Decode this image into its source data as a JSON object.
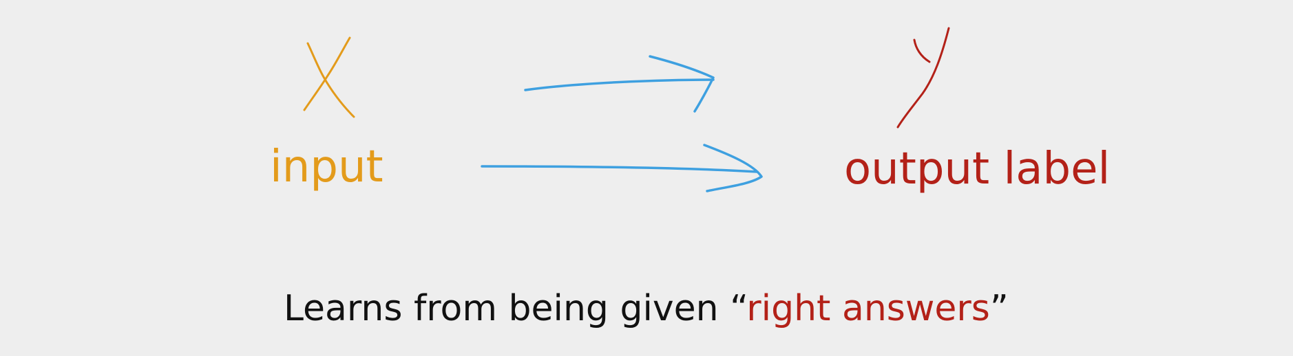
{
  "diagram": {
    "x_symbol": "X",
    "y_symbol": "Y",
    "input_label": "input",
    "output_label": "output label",
    "caption": {
      "prefix": "Learns from being given “",
      "highlight": "right answers",
      "suffix": "”"
    }
  },
  "colors": {
    "background": "#eeeeee",
    "input": "#e39b1b",
    "output": "#b32118",
    "arrow": "#3ea0e0",
    "text": "#111111"
  }
}
